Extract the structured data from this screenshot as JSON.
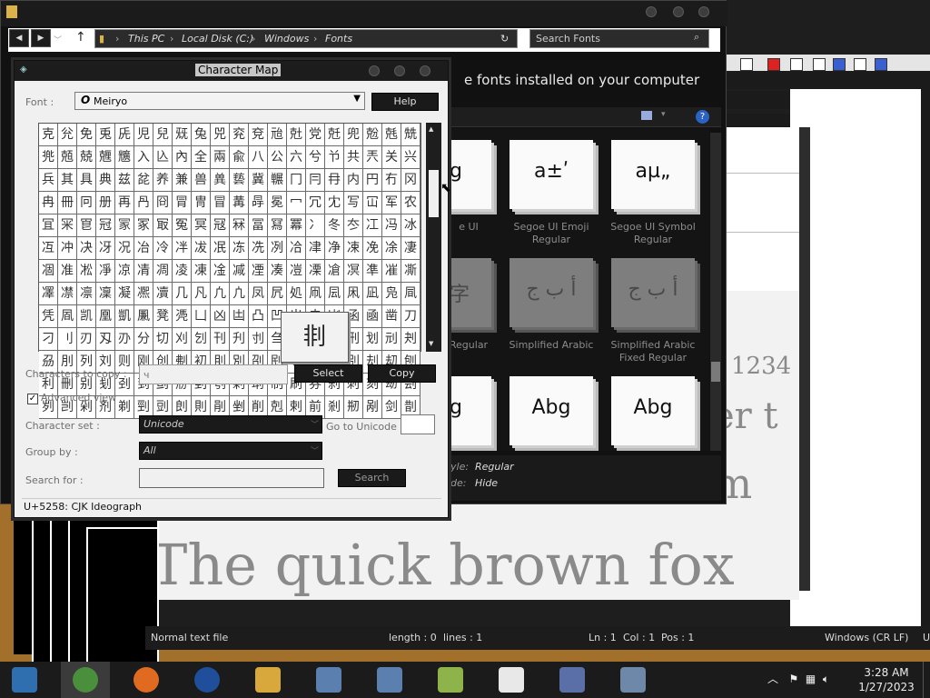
{
  "fonts_window": {
    "address_parts": [
      "This PC",
      "Local Disk (C:)",
      "Windows",
      "Fonts"
    ],
    "search_placeholder": "Search Fonts",
    "heading": "e fonts installed on your computer",
    "tiles": [
      {
        "glyph": "bg",
        "label_line1": "e UI",
        "label_line2": "",
        "gray": false
      },
      {
        "glyph": "a±ʹ",
        "label_line1": "Segoe UI Emoji",
        "label_line2": "Regular",
        "gray": false
      },
      {
        "glyph": "aµ„",
        "label_line1": "Segoe UI Symbol",
        "label_line2": "Regular",
        "gray": false
      },
      {
        "glyph": "本字",
        "label_line1": "Regular",
        "label_line2": "",
        "gray": true
      },
      {
        "glyph": "أ ب ج",
        "label_line1": "Simplified Arabic",
        "label_line2": "",
        "gray": true
      },
      {
        "glyph": "أ ب ج",
        "label_line1": "Simplified Arabic",
        "label_line2": "Fixed Regular",
        "gray": true
      },
      {
        "glyph": "bg",
        "label_line1": "",
        "label_line2": "",
        "gray": false
      },
      {
        "glyph": "Abg",
        "label_line1": "",
        "label_line2": "",
        "gray": false
      },
      {
        "glyph": "Abg",
        "label_line1": "",
        "label_line2": "",
        "gray": false
      }
    ],
    "details": {
      "style_label": "yle:",
      "style_value": "Regular",
      "hide_label": "de:",
      "hide_value": "Hide"
    }
  },
  "notepad": {
    "sample_text": "The quick brown fox",
    "sample_partial_1": "1234",
    "sample_partial_2": "er t",
    "sample_partial_3": "um",
    "status": {
      "file_type": "Normal text file",
      "length": "length : 0",
      "lines": "lines : 1",
      "ln": "Ln : 1",
      "col": "Col : 1",
      "pos": "Pos : 1",
      "eol": "Windows (CR LF)",
      "enc": "U"
    }
  },
  "charmap": {
    "title": "Character Map",
    "font_label": "Font :",
    "font_value": "Meiryo",
    "help_label": "Help",
    "characters": [
      "克",
      "兊",
      "免",
      "兎",
      "兏",
      "児",
      "兒",
      "兓",
      "兔",
      "兕",
      "兖",
      "兗",
      "兘",
      "兙",
      "党",
      "兛",
      "兜",
      "兝",
      "兞",
      "兟",
      "兠",
      "兡",
      "兢",
      "兣",
      "兤",
      "入",
      "兦",
      "內",
      "全",
      "兩",
      "兪",
      "八",
      "公",
      "六",
      "兮",
      "兯",
      "共",
      "兲",
      "关",
      "兴",
      "兵",
      "其",
      "具",
      "典",
      "兹",
      "兺",
      "养",
      "兼",
      "兽",
      "兾",
      "兿",
      "冀",
      "冁",
      "冂",
      "冃",
      "冄",
      "内",
      "円",
      "冇",
      "冈",
      "冉",
      "冊",
      "冋",
      "册",
      "再",
      "冎",
      "冏",
      "冐",
      "冑",
      "冒",
      "冓",
      "冔",
      "冕",
      "冖",
      "冗",
      "冘",
      "写",
      "冚",
      "军",
      "农",
      "冝",
      "冞",
      "冟",
      "冠",
      "冡",
      "冢",
      "冣",
      "冤",
      "冥",
      "冦",
      "冧",
      "冨",
      "冩",
      "冪",
      "冫",
      "冬",
      "冭",
      "冮",
      "冯",
      "冰",
      "冱",
      "冲",
      "决",
      "冴",
      "况",
      "冶",
      "冷",
      "冸",
      "冹",
      "冺",
      "冻",
      "冼",
      "冽",
      "冾",
      "冿",
      "净",
      "凁",
      "凂",
      "凃",
      "凄",
      "凅",
      "准",
      "凇",
      "凈",
      "凉",
      "凊",
      "凋",
      "凌",
      "凍",
      "凎",
      "减",
      "凐",
      "凑",
      "凒",
      "凓",
      "凔",
      "凕",
      "凖",
      "凗",
      "凘",
      "凙",
      "凚",
      "凛",
      "凜",
      "凝",
      "凞",
      "凟",
      "几",
      "凡",
      "凢",
      "凣",
      "凤",
      "凥",
      "処",
      "凧",
      "凨",
      "凩",
      "凪",
      "凫",
      "凬",
      "凭",
      "凮",
      "凯",
      "凰",
      "凱",
      "凲",
      "凳",
      "凴",
      "凵",
      "凶",
      "凷",
      "凸",
      "凹",
      "出",
      "击",
      "凼",
      "函",
      "凾",
      "凿",
      "刀",
      "刁",
      "刂",
      "刃",
      "刄",
      "刅",
      "分",
      "切",
      "刈",
      "刉",
      "刊",
      "刋",
      "刌",
      "刍",
      "刎",
      "刏",
      "刐",
      "刑",
      "划",
      "刓",
      "刔",
      "刕",
      "刖",
      "列",
      "刘",
      "则",
      "刚",
      "创",
      "刜",
      "初",
      "刞",
      "別",
      "刟",
      "刡",
      "刢",
      "刣",
      "判",
      "別",
      "刦",
      "刧",
      "刨",
      "利",
      "刪",
      "别",
      "刬",
      "刭",
      "到",
      "刯",
      "刱",
      "刲",
      "刳",
      "刴",
      "刵",
      "制",
      "刷",
      "券",
      "刹",
      "刺",
      "刻",
      "刼",
      "刽",
      "刿",
      "剀",
      "剁",
      "剂",
      "剃",
      "剄",
      "剅",
      "剆",
      "則",
      "剈",
      "剉",
      "削",
      "剋",
      "剌",
      "前",
      "剎",
      "剏",
      "剐",
      "剑",
      "剒"
    ],
    "zoom_char": "剕",
    "copy_label": "Characters to copy :",
    "copy_value": "ч",
    "select_label": "Select",
    "copy_btn_label": "Copy",
    "advanced_label": "Advanced view",
    "charset_label": "Character set :",
    "charset_value": "Unicode",
    "goto_label": "Go to Unicode :",
    "groupby_label": "Group by :",
    "groupby_value": "All",
    "search_label": "Search for :",
    "search_btn_label": "Search",
    "status_text": "U+5258: CJK Ideograph"
  },
  "taskbar": {
    "time": "3:28 AM",
    "date": "1/27/2023",
    "apps": [
      {
        "name": "photos",
        "color": "#2f6fb0"
      },
      {
        "name": "chrome",
        "color": "#4a8f3c"
      },
      {
        "name": "firefox",
        "color": "#e06a20"
      },
      {
        "name": "obama",
        "color": "#1f4f9a"
      },
      {
        "name": "explorer",
        "color": "#d8a83c"
      },
      {
        "name": "installer",
        "color": "#5b7fae"
      },
      {
        "name": "installer2",
        "color": "#5b7fae"
      },
      {
        "name": "notepadpp",
        "color": "#8db34a"
      },
      {
        "name": "7zip",
        "color": "#e8e8e8"
      },
      {
        "name": "font-tool",
        "color": "#5a6fa8"
      },
      {
        "name": "charmap",
        "color": "#6d88a8"
      }
    ]
  }
}
